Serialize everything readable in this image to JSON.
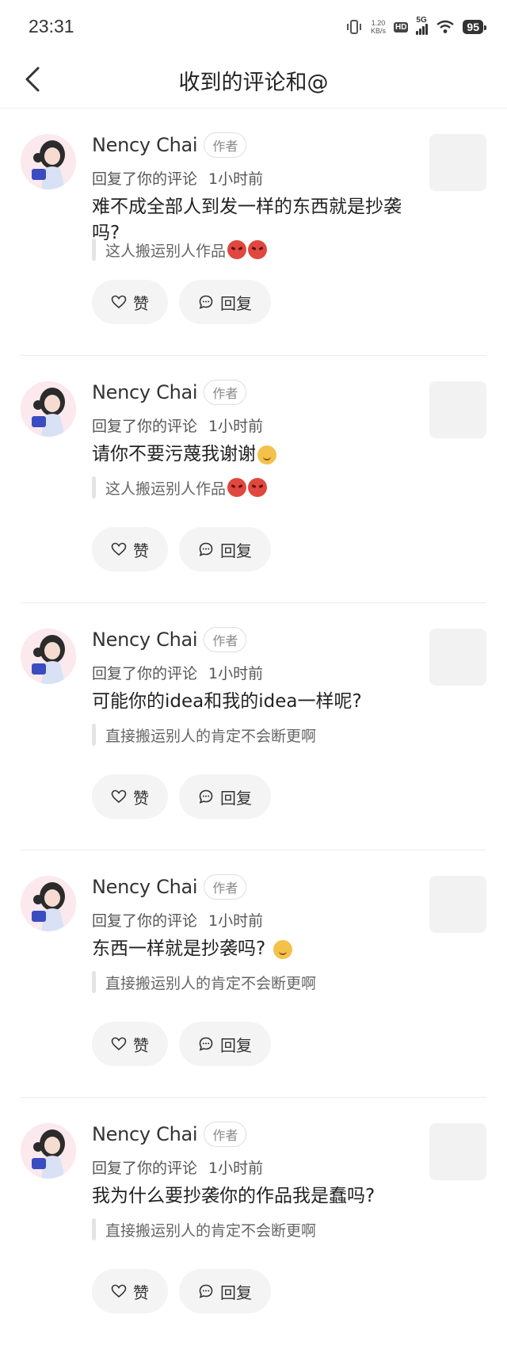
{
  "status_bar": {
    "time": "23:31",
    "net_speed_value": "1.20",
    "net_speed_unit": "KB/s",
    "hd": "HD",
    "network": "5G",
    "battery": "95"
  },
  "header": {
    "title": "收到的评论和@"
  },
  "comments": [
    {
      "username": "Nency Chai",
      "badge": "作者",
      "action": "回复了你的评论",
      "time": "1小时前",
      "text": "难不成全部人到发一样的东西就是抄袭吗?",
      "quote": "这人搬运别人作品",
      "like_label": "赞",
      "reply_label": "回复"
    },
    {
      "username": "Nency Chai",
      "badge": "作者",
      "action": "回复了你的评论",
      "time": "1小时前",
      "text": "请你不要污蔑我谢谢",
      "quote": "这人搬运别人作品",
      "like_label": "赞",
      "reply_label": "回复"
    },
    {
      "username": "Nency Chai",
      "badge": "作者",
      "action": "回复了你的评论",
      "time": "1小时前",
      "text": "可能你的idea和我的idea一样呢?",
      "quote": "直接搬运别人的肯定不会断更啊",
      "like_label": "赞",
      "reply_label": "回复"
    },
    {
      "username": "Nency Chai",
      "badge": "作者",
      "action": "回复了你的评论",
      "time": "1小时前",
      "text": "东西一样就是抄袭吗?",
      "quote": "直接搬运别人的肯定不会断更啊",
      "like_label": "赞",
      "reply_label": "回复"
    },
    {
      "username": "Nency Chai",
      "badge": "作者",
      "action": "回复了你的评论",
      "time": "1小时前",
      "text": "我为什么要抄袭你的作品我是蠢吗?",
      "quote": "直接搬运别人的肯定不会断更啊",
      "like_label": "赞",
      "reply_label": "回复"
    }
  ],
  "icons": {
    "back": "chevron-left-icon",
    "like": "heart-icon",
    "reply": "comment-bubble-icon",
    "emoji_angry": "angry-devil-emoji",
    "emoji_mango": "mango-smile-emoji"
  },
  "colors": {
    "background": "#ffffff",
    "button_bg": "#f4f4f4",
    "divider": "#ececec",
    "thumbnail_placeholder": "#f2f2f2"
  }
}
